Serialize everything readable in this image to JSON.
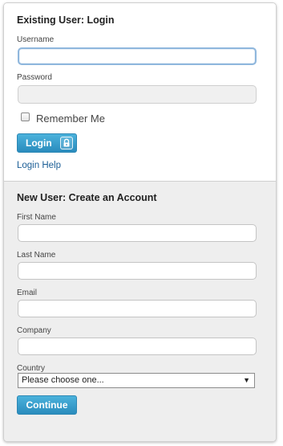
{
  "login": {
    "title": "Existing User: Login",
    "username_label": "Username",
    "username_value": "",
    "password_label": "Password",
    "password_value": "",
    "remember_label": "Remember Me",
    "remember_checked": false,
    "login_button": "Login",
    "lock_icon": "lock-icon",
    "help_link": "Login Help"
  },
  "register": {
    "title": "New User: Create an Account",
    "first_name_label": "First Name",
    "last_name_label": "Last Name",
    "email_label": "Email",
    "company_label": "Company",
    "country_label": "Country",
    "country_selected": "Please choose one...",
    "continue_button": "Continue"
  },
  "colors": {
    "button": "#2a8cbd",
    "link": "#1b5e96",
    "register_background": "#eeeeee",
    "focus_border": "#8fb7dd"
  }
}
